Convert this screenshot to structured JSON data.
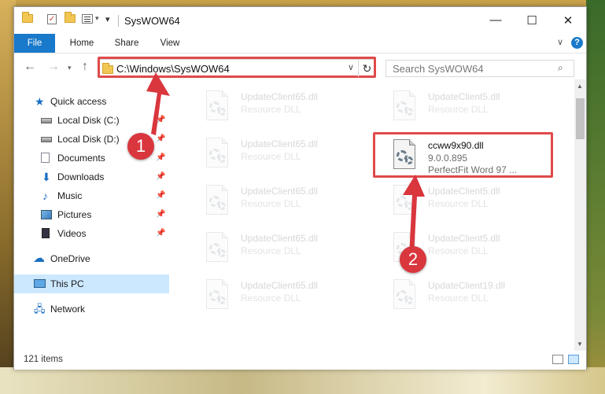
{
  "window": {
    "title": "SysWOW64"
  },
  "ribbon": {
    "tabs": [
      {
        "label": "File"
      },
      {
        "label": "Home"
      },
      {
        "label": "Share"
      },
      {
        "label": "View"
      }
    ],
    "collapse_symbol": "∨",
    "help_symbol": "?"
  },
  "address": {
    "path": "C:\\Windows\\SysWOW64",
    "dropdown_symbol": "∨",
    "refresh_symbol": "↻"
  },
  "search": {
    "placeholder": "Search SysWOW64",
    "icon": "search-icon"
  },
  "nav": {
    "quick_access": "Quick access",
    "items": [
      {
        "label": "Local Disk (C:)",
        "icon": "drive-icon",
        "pinned": true
      },
      {
        "label": "Local Disk (D:)",
        "icon": "drive-icon",
        "pinned": true
      },
      {
        "label": "Documents",
        "icon": "documents-icon",
        "pinned": true
      },
      {
        "label": "Downloads",
        "icon": "downloads-icon",
        "pinned": true
      },
      {
        "label": "Music",
        "icon": "music-icon",
        "pinned": true
      },
      {
        "label": "Pictures",
        "icon": "pictures-icon",
        "pinned": true
      },
      {
        "label": "Videos",
        "icon": "videos-icon",
        "pinned": true
      }
    ],
    "onedrive": "OneDrive",
    "this_pc": "This PC",
    "network": "Network"
  },
  "files": {
    "left_column": [
      {
        "name": "UpdateClient65.dll",
        "type": "Resource DLL"
      },
      {
        "name": "UpdateClient65.dll",
        "type": "Resource DLL"
      },
      {
        "name": "UpdateClient65.dll",
        "type": "Resource DLL"
      },
      {
        "name": "UpdateClient65.dll",
        "type": "Resource DLL"
      },
      {
        "name": "UpdateClient65.dll",
        "type": "Resource DLL"
      }
    ],
    "right_column": [
      {
        "name": "UpdateClient5.dll",
        "type": "Resource DLL"
      },
      {
        "name": "UpdateClient5.dll",
        "type": "Resource DLL"
      },
      {
        "name": "UpdateClient5.dll",
        "type": "Resource DLL"
      },
      {
        "name": "UpdateClient19.dll",
        "type": "Resource DLL"
      }
    ],
    "highlighted": {
      "name": "ccww9x90.dll",
      "version": "9.0.0.895",
      "description": "PerfectFit Word 97 ..."
    }
  },
  "status": {
    "item_count": "121 items"
  },
  "markers": {
    "step1": "1",
    "step2": "2"
  },
  "colors": {
    "accent": "#1979ca",
    "highlight": "#e04a4a",
    "marker": "#d9363e"
  }
}
